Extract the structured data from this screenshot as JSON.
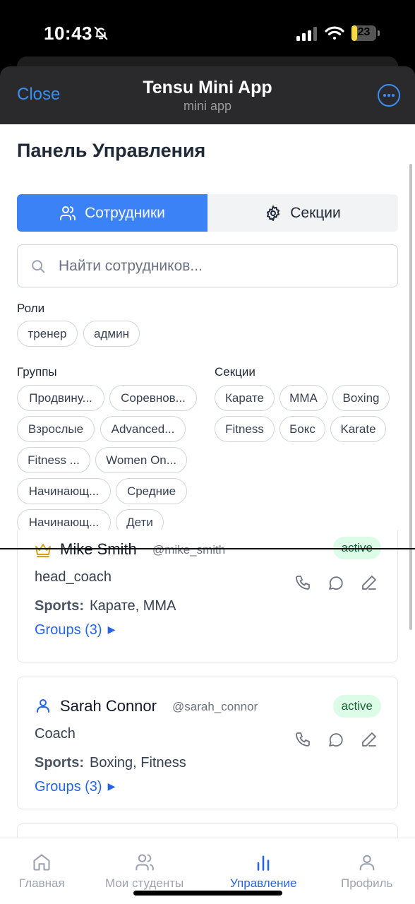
{
  "status_bar": {
    "time": "10:43",
    "battery": "23",
    "battery_level": 0.23
  },
  "app": {
    "close_label": "Close",
    "title": "Tensu Mini App",
    "subtitle": "mini app",
    "accent": "#3a8ef5"
  },
  "page": {
    "title": "Панель Управления"
  },
  "tabs": {
    "staff": "Сотрудники",
    "sections": "Секции",
    "active": "staff"
  },
  "search": {
    "placeholder": "Найти сотрудников..."
  },
  "filters": {
    "roles_label": "Роли",
    "roles": [
      "тренер",
      "админ"
    ],
    "groups_label": "Группы",
    "groups": [
      "Продвину...",
      "Соревнов...",
      "Взрослые",
      "Advanced...",
      "Fitness ...",
      "Women On...",
      "Начинающ...",
      "Средние",
      "Начинающ...",
      "Дети"
    ],
    "sections_label": "Секции",
    "sections": [
      "Карате",
      "MMA",
      "Boxing",
      "Fitness",
      "Бокс",
      "Karate"
    ]
  },
  "staff": [
    {
      "icon": "crown-icon",
      "name": "Mike Smith",
      "handle": "@mike_smith",
      "status": "active",
      "role": "head_coach",
      "sports_label": "Sports:",
      "sports": "Карате, MMA",
      "groups": "Groups (3)"
    },
    {
      "icon": "user-icon",
      "name": "Sarah Connor",
      "handle": "@sarah_connor",
      "status": "active",
      "role": "Coach",
      "sports_label": "Sports:",
      "sports": "Boxing, Fitness",
      "groups": "Groups (3)"
    }
  ],
  "nav": {
    "home": "Главная",
    "students": "Мои студенты",
    "manage": "Управление",
    "profile": "Профиль",
    "active": "manage"
  }
}
